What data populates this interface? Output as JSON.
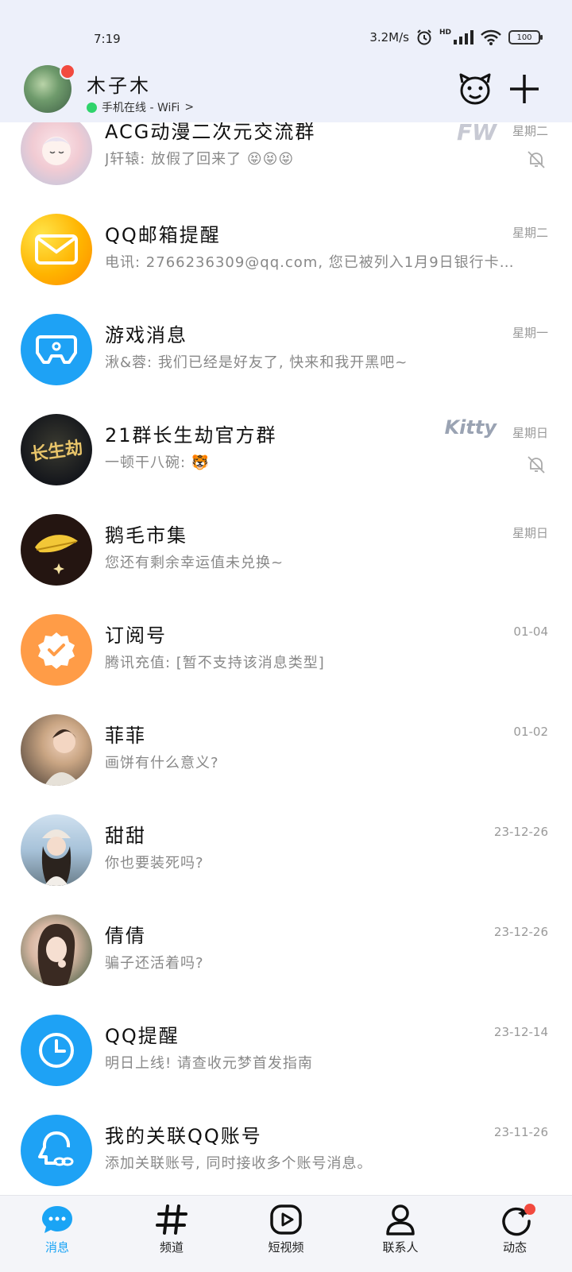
{
  "status_bar": {
    "time": "7:19",
    "speed": "3.2M/s",
    "signal_tag": "HD",
    "battery": "100"
  },
  "header": {
    "user_name": "木子木",
    "status_text": "手机在线 - WiFi",
    "status_chevron": ">"
  },
  "conversations": [
    {
      "title": "ACG动漫二次元交流群",
      "message": "J轩辕: 放假了回来了 😝😝😝",
      "time": "星期二",
      "muted": true,
      "deco": "FW"
    },
    {
      "title": "QQ邮箱提醒",
      "message": "电讯: 2766236309@qq.com, 您已被列入1月9日银行卡的…",
      "time": "星期二",
      "muted": false
    },
    {
      "title": "游戏消息",
      "message": "湫&蓉: 我们已经是好友了, 快来和我开黑吧~",
      "time": "星期一",
      "muted": false
    },
    {
      "title": "21群长生劫官方群",
      "message": "一顿干八碗: 🐯",
      "time": "星期日",
      "muted": true,
      "deco": "Kitty",
      "avatar_text": "长生劫"
    },
    {
      "title": "鹅毛市集",
      "message": "您还有剩余幸运值未兑换~",
      "time": "星期日",
      "muted": false
    },
    {
      "title": "订阅号",
      "message": "腾讯充值: [暂不支持该消息类型]",
      "time": "01-04",
      "muted": false
    },
    {
      "title": "菲菲",
      "message": "画饼有什么意义?",
      "time": "01-02",
      "muted": false
    },
    {
      "title": "甜甜",
      "message": "你也要装死吗?",
      "time": "23-12-26",
      "muted": false
    },
    {
      "title": "倩倩",
      "message": "骗子还活着吗?",
      "time": "23-12-26",
      "muted": false
    },
    {
      "title": "QQ提醒",
      "message": "明日上线! 请查收元梦首发指南",
      "time": "23-12-14",
      "muted": false
    },
    {
      "title": "我的关联QQ账号",
      "message": "添加关联账号, 同时接收多个账号消息。",
      "time": "23-11-26",
      "muted": false
    }
  ],
  "tabs": [
    {
      "label": "消息",
      "icon": "message-bubble-icon",
      "active": true
    },
    {
      "label": "频道",
      "icon": "hash-icon",
      "active": false
    },
    {
      "label": "短视频",
      "icon": "video-play-icon",
      "active": false
    },
    {
      "label": "联系人",
      "icon": "person-icon",
      "active": false
    },
    {
      "label": "动态",
      "icon": "refresh-star-icon",
      "active": false
    }
  ],
  "colors": {
    "accent": "#1aa4f5",
    "badge": "#f24a3f",
    "online": "#2fd36b",
    "header_bg": "#edf0fa"
  }
}
